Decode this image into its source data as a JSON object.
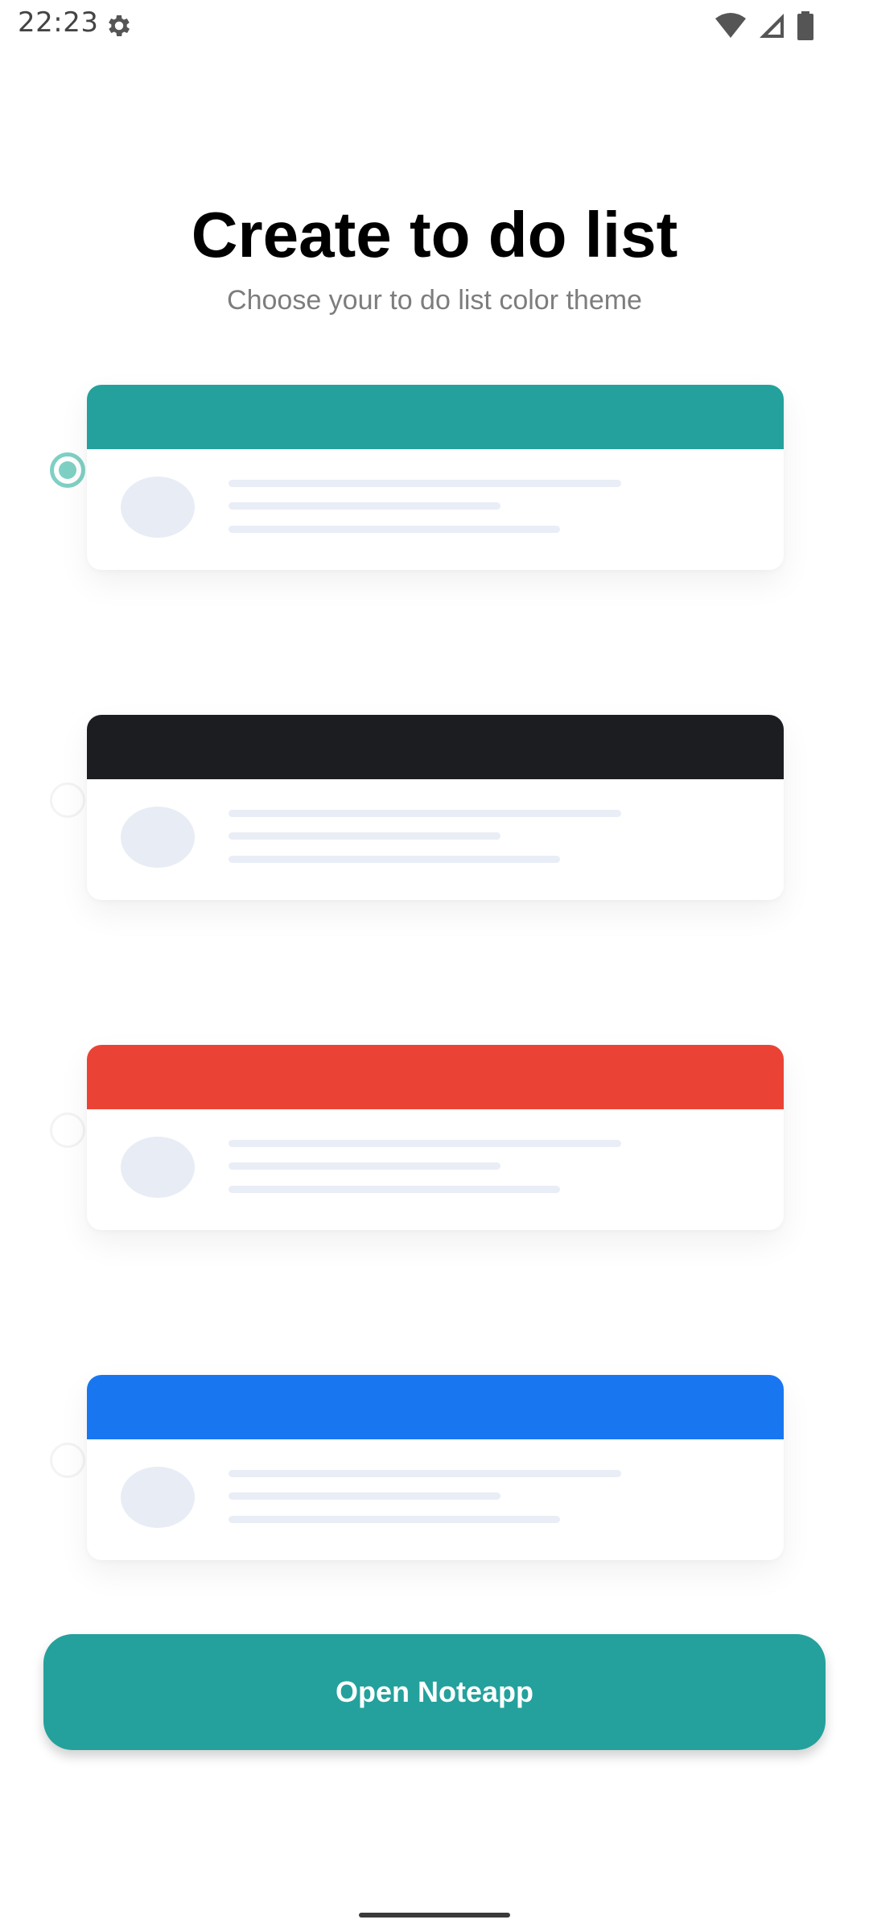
{
  "status_bar": {
    "time": "22:23",
    "icons": [
      "gear-icon",
      "wifi-icon",
      "signal-icon",
      "battery-icon"
    ]
  },
  "header": {
    "title": "Create to do list",
    "subtitle": "Choose your to do list color theme"
  },
  "themes": [
    {
      "name": "teal",
      "color": "#24a19c",
      "selected": true
    },
    {
      "name": "black",
      "color": "#1c1d21",
      "selected": false
    },
    {
      "name": "red",
      "color": "#ea4335",
      "selected": false
    },
    {
      "name": "blue",
      "color": "#1877f0",
      "selected": false
    }
  ],
  "button": {
    "label": "Open Noteapp",
    "color": "#24a19c"
  }
}
